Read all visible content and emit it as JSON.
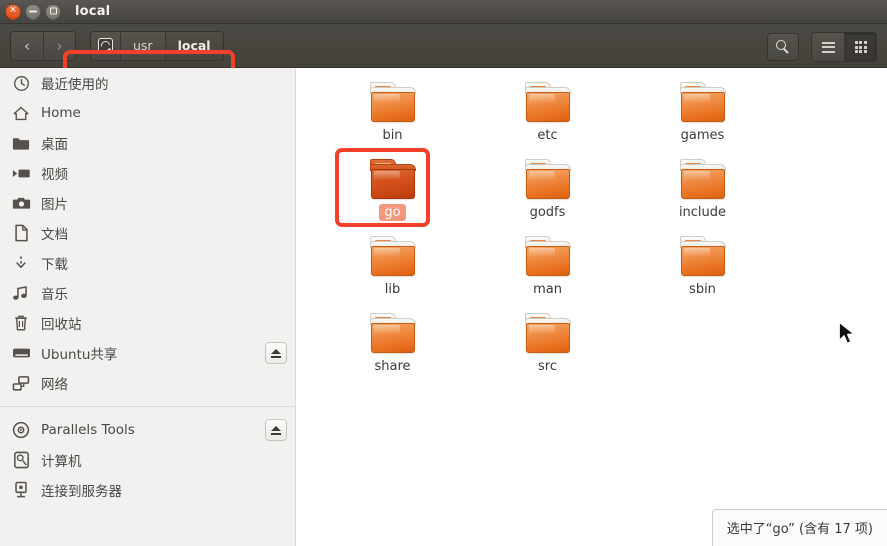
{
  "window": {
    "title": "local",
    "buttons": {
      "close": "close-button",
      "minimize": "minimize-button",
      "maximize": "maximize-button"
    }
  },
  "toolbar": {
    "back_label": "‹",
    "forward_label": "›",
    "breadcrumbs": [
      {
        "label": "",
        "icon": "computer-icon",
        "current": false
      },
      {
        "label": "usr",
        "icon": "",
        "current": false
      },
      {
        "label": "local",
        "icon": "",
        "current": true
      }
    ],
    "search_label": "search-icon",
    "view_list_label": "list-view-icon",
    "view_grid_label": "grid-view-icon"
  },
  "sidebar": {
    "groups": [
      {
        "items": [
          {
            "label": "最近使用的",
            "icon": "clock-icon",
            "eject": false
          },
          {
            "label": "Home",
            "icon": "home-icon",
            "eject": false
          },
          {
            "label": "桌面",
            "icon": "folder-icon",
            "eject": false
          },
          {
            "label": "视频",
            "icon": "video-icon",
            "eject": false
          },
          {
            "label": "图片",
            "icon": "camera-icon",
            "eject": false
          },
          {
            "label": "文档",
            "icon": "document-icon",
            "eject": false
          },
          {
            "label": "下载",
            "icon": "download-icon",
            "eject": false
          },
          {
            "label": "音乐",
            "icon": "music-icon",
            "eject": false
          },
          {
            "label": "回收站",
            "icon": "trash-icon",
            "eject": false
          },
          {
            "label": "Ubuntu共享",
            "icon": "drive-icon",
            "eject": true
          },
          {
            "label": "网络",
            "icon": "network-icon",
            "eject": false
          }
        ]
      },
      {
        "items": [
          {
            "label": "Parallels Tools",
            "icon": "disc-icon",
            "eject": true
          },
          {
            "label": "计算机",
            "icon": "computer-icon",
            "eject": false
          },
          {
            "label": "连接到服务器",
            "icon": "server-connect-icon",
            "eject": false
          }
        ]
      }
    ]
  },
  "content": {
    "items": [
      {
        "name": "bin",
        "selected": false
      },
      {
        "name": "etc",
        "selected": false
      },
      {
        "name": "games",
        "selected": false
      },
      {
        "name": "go",
        "selected": true
      },
      {
        "name": "godfs",
        "selected": false
      },
      {
        "name": "include",
        "selected": false
      },
      {
        "name": "lib",
        "selected": false
      },
      {
        "name": "man",
        "selected": false
      },
      {
        "name": "sbin",
        "selected": false
      },
      {
        "name": "share",
        "selected": false
      },
      {
        "name": "src",
        "selected": false
      }
    ]
  },
  "statusbar": {
    "text": "选中了“go” (含有 17 项)"
  },
  "annotations": {
    "breadcrumb_highlight": "red-rectangle-breadcrumb",
    "go_folder_highlight": "red-rectangle-go-folder",
    "color": "#f4402a"
  }
}
